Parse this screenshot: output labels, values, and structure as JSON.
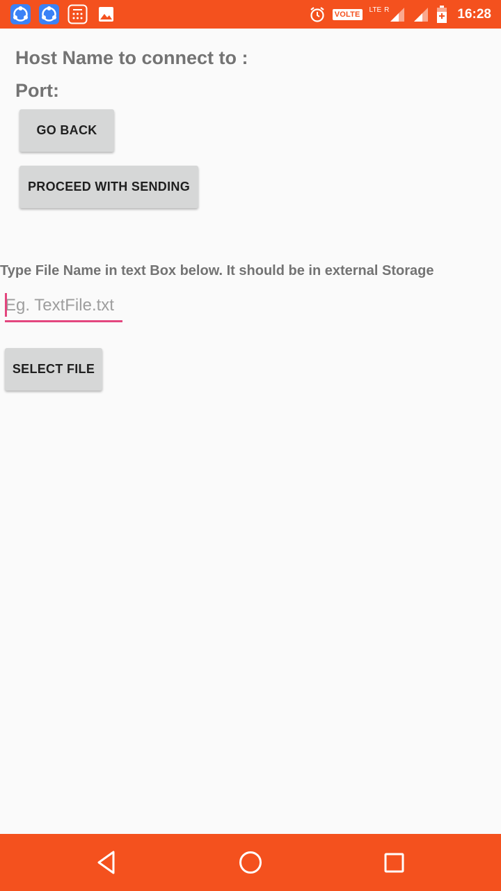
{
  "status_bar": {
    "time": "16:28",
    "volte": "VOLTE",
    "lte": "LTE",
    "roaming": "R",
    "icons": [
      "shareit-icon",
      "shareit-icon",
      "calculator-icon",
      "gallery-icon",
      "alarm-icon",
      "signal-icon",
      "signal-icon",
      "battery-icon"
    ]
  },
  "main": {
    "host_label": "Host Name to connect to :",
    "port_label": "Port:",
    "go_back_label": "GO BACK",
    "proceed_label": "PROCEED WITH SENDING",
    "instruction": "Type File Name in text Box below. It should be in external Storage",
    "file_input": {
      "value": "",
      "placeholder": "Eg. TextFile.txt"
    },
    "select_file_label": "SELECT FILE"
  },
  "nav": {
    "icons": [
      "back-icon",
      "home-icon",
      "recents-icon"
    ]
  },
  "colors": {
    "accent": "#f4511e",
    "input_accent": "#e3467e",
    "button_bg": "#d6d7d7",
    "text_gray": "#737373"
  }
}
